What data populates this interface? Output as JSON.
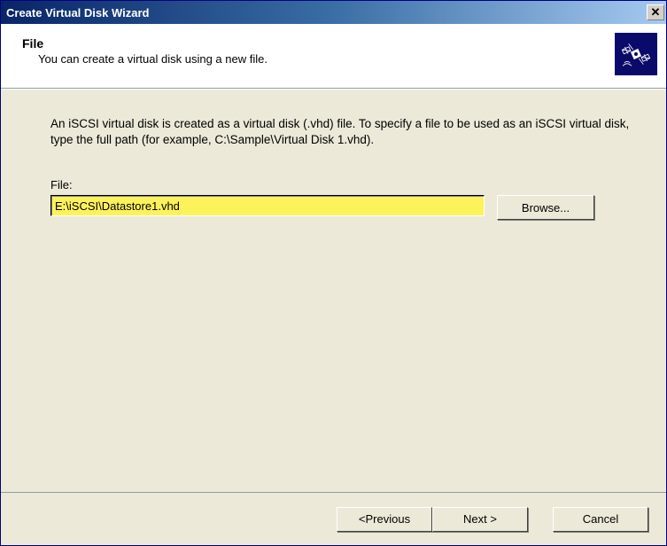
{
  "window": {
    "title": "Create Virtual Disk Wizard"
  },
  "header": {
    "title": "File",
    "subtitle": "You can create a virtual disk using a new file."
  },
  "content": {
    "description": "An iSCSI virtual disk is created as a virtual disk (.vhd) file. To specify a file to be used as an iSCSI virtual disk, type the full path (for example, C:\\Sample\\Virtual Disk 1.vhd).",
    "file_label": "File:",
    "file_value": "E:\\iSCSI\\Datastore1.vhd",
    "browse_label": "Browse..."
  },
  "buttons": {
    "previous": "<Previous",
    "next": "Next >",
    "cancel": "Cancel"
  }
}
